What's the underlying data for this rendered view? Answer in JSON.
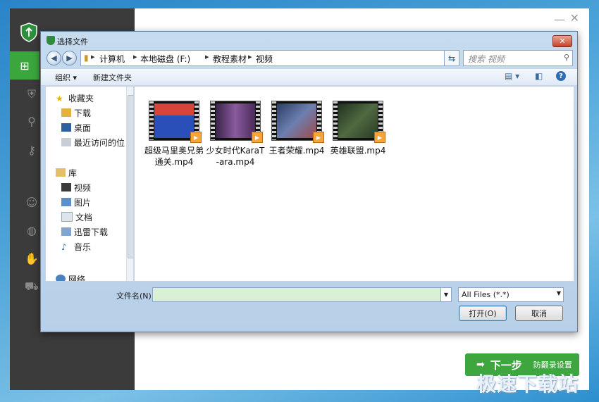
{
  "app": {
    "next_button": {
      "label": "下一步",
      "sub_label": "防翻录设置"
    },
    "window_controls": {
      "minimize": "—",
      "close": "✕"
    }
  },
  "dialog": {
    "title": "选择文件",
    "close_glyph": "✕",
    "breadcrumb": [
      "计算机",
      "本地磁盘 (F:)",
      "教程素材",
      "视频"
    ],
    "search_placeholder": "搜索 视频",
    "toolbar": {
      "organize": "组织 ▾",
      "new_folder": "新建文件夹"
    },
    "nav": {
      "items": [
        {
          "label": "收藏夹",
          "icon": "star-icon",
          "level": 0
        },
        {
          "label": "下载",
          "icon": "downloads-folder-icon",
          "level": 1
        },
        {
          "label": "桌面",
          "icon": "desktop-icon",
          "level": 1
        },
        {
          "label": "最近访问的位",
          "icon": "recent-places-icon",
          "level": 1
        },
        {
          "label": "库",
          "icon": "library-icon",
          "level": 0
        },
        {
          "label": "视频",
          "icon": "videos-icon",
          "level": 1
        },
        {
          "label": "图片",
          "icon": "pictures-icon",
          "level": 1
        },
        {
          "label": "文档",
          "icon": "documents-icon",
          "level": 1
        },
        {
          "label": "迅雷下载",
          "icon": "thunder-download-icon",
          "level": 1
        },
        {
          "label": "音乐",
          "icon": "music-icon",
          "level": 1
        },
        {
          "label": "网络",
          "icon": "network-icon",
          "level": 0
        }
      ]
    },
    "files": [
      {
        "name": "超级马里奥兄弟通关.mp4",
        "thumb_color": "#2a4fb8"
      },
      {
        "name": "少女时代KaraT-ara.mp4",
        "thumb_color": "#6a3c7a"
      },
      {
        "name": "王者荣耀.mp4",
        "thumb_color": "#4a5a86"
      },
      {
        "name": "英雄联盟.mp4",
        "thumb_color": "#3f5a34"
      }
    ],
    "filename_label": "文件名(N):",
    "filename_value": "",
    "filter_value": "All Files (*.*)",
    "open_label": "打开(O)",
    "cancel_label": "取消"
  },
  "watermark": "极速下载站",
  "colors": {
    "accent_green": "#3da63e",
    "sidebar": "#3b3b3b"
  }
}
